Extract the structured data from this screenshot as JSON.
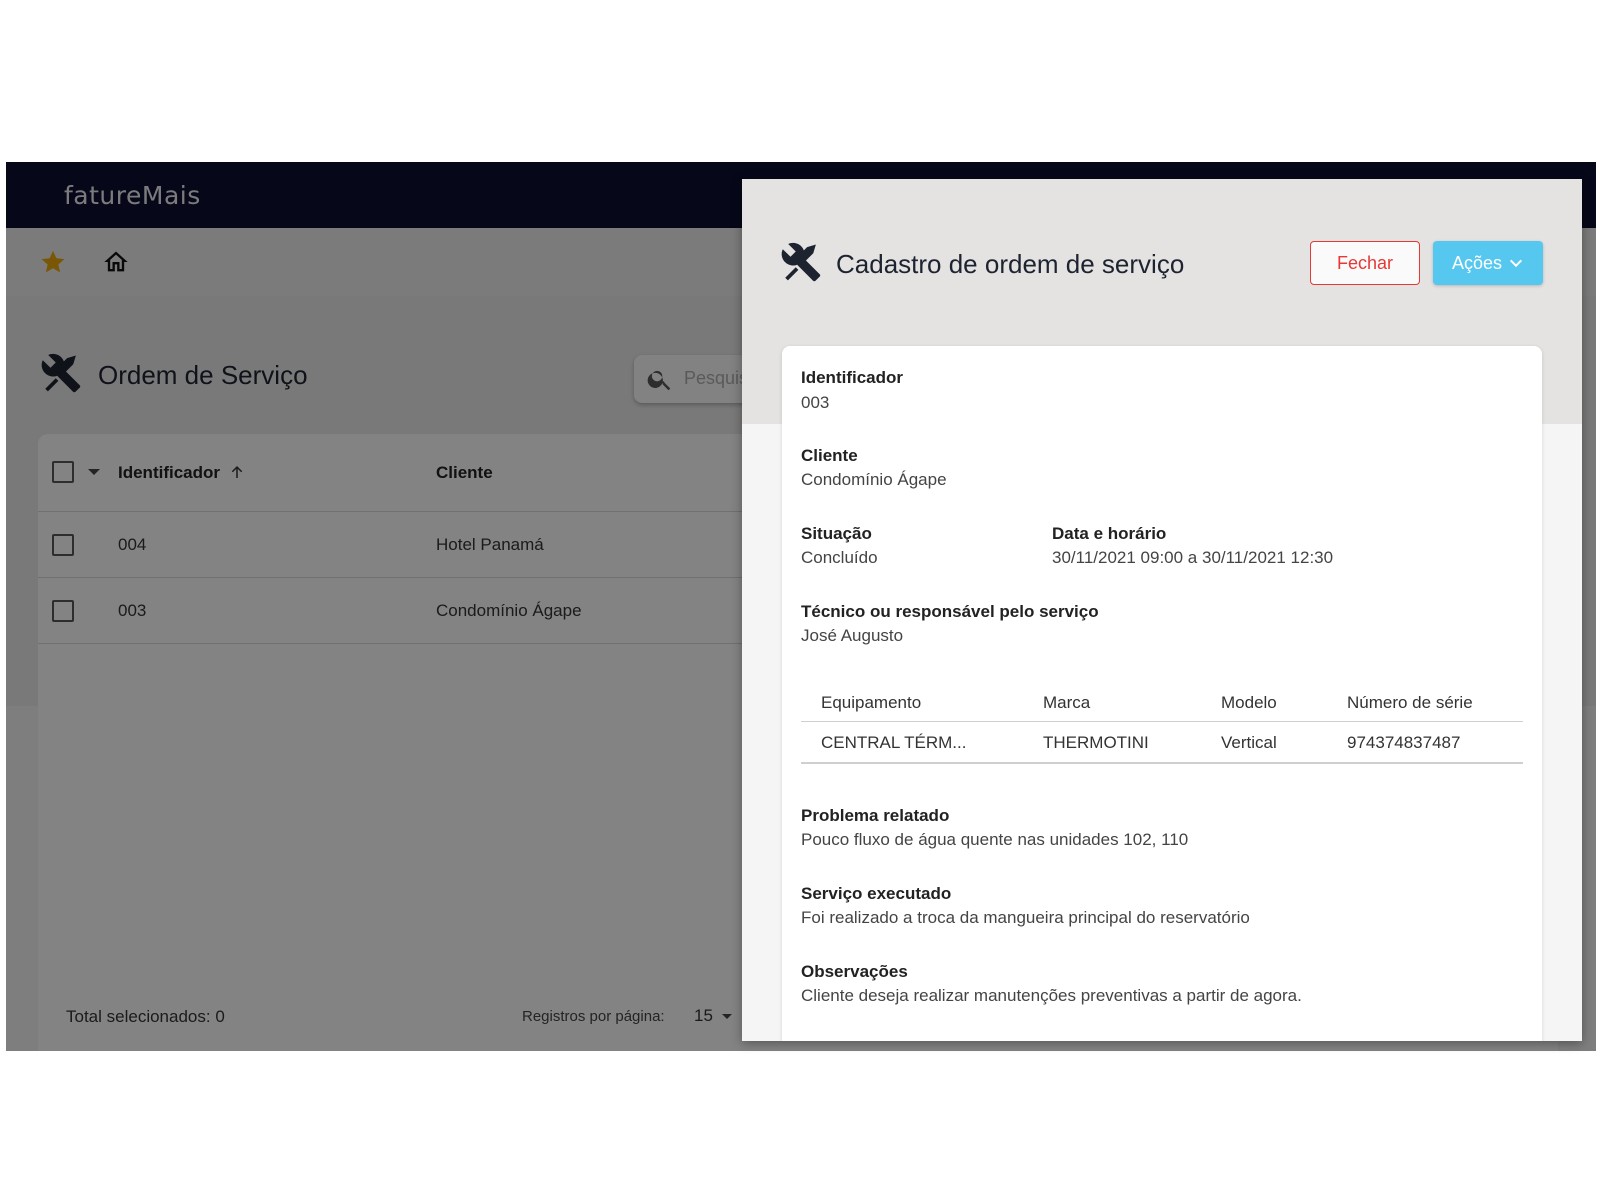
{
  "app": {
    "logo_text": "fatureMais",
    "page_title": "Ordem de Serviço",
    "search_placeholder": "Pesquis",
    "grid": {
      "columns": {
        "identificador": "Identificador",
        "cliente": "Cliente"
      },
      "rows": [
        {
          "identificador": "004",
          "cliente": "Hotel Panamá"
        },
        {
          "identificador": "003",
          "cliente": "Condomínio Ágape"
        }
      ]
    },
    "footer": {
      "total_label": "Total selecionados:  0",
      "rows_per_page_label": "Registros por página:",
      "rows_per_page_value": "15"
    },
    "colors": {
      "star": "#e6a20e",
      "topbar": "#0c1030"
    }
  },
  "modal": {
    "title": "Cadastro de ordem de serviço",
    "close_label": "Fechar",
    "actions_label": "Ações",
    "fields": {
      "identificador": {
        "label": "Identificador",
        "value": "003"
      },
      "cliente": {
        "label": "Cliente",
        "value": "Condomínio Ágape"
      },
      "situacao": {
        "label": "Situação",
        "value": "Concluído"
      },
      "data": {
        "label": "Data e horário",
        "value": "30/11/2021 09:00 a 30/11/2021 12:30"
      },
      "tecnico": {
        "label": "Técnico ou responsável pelo serviço",
        "value": "José Augusto"
      },
      "problema": {
        "label": "Problema relatado",
        "value": "Pouco fluxo de água quente nas unidades 102, 110"
      },
      "servico": {
        "label": "Serviço executado",
        "value": "Foi realizado a troca da mangueira principal do reservatório"
      },
      "observacoes": {
        "label": "Observações",
        "value": "Cliente deseja realizar manutenções preventivas a partir de agora."
      }
    },
    "equipment": {
      "columns": {
        "equipamento": "Equipamento",
        "marca": "Marca",
        "modelo": "Modelo",
        "serie": "Número de série"
      },
      "rows": [
        {
          "equipamento": "CENTRAL TÉRM...",
          "marca": "THERMOTINI",
          "modelo": "Vertical",
          "serie": "974374837487"
        }
      ]
    },
    "colors": {
      "close": "#e53935",
      "actions": "#56c8ef"
    }
  }
}
